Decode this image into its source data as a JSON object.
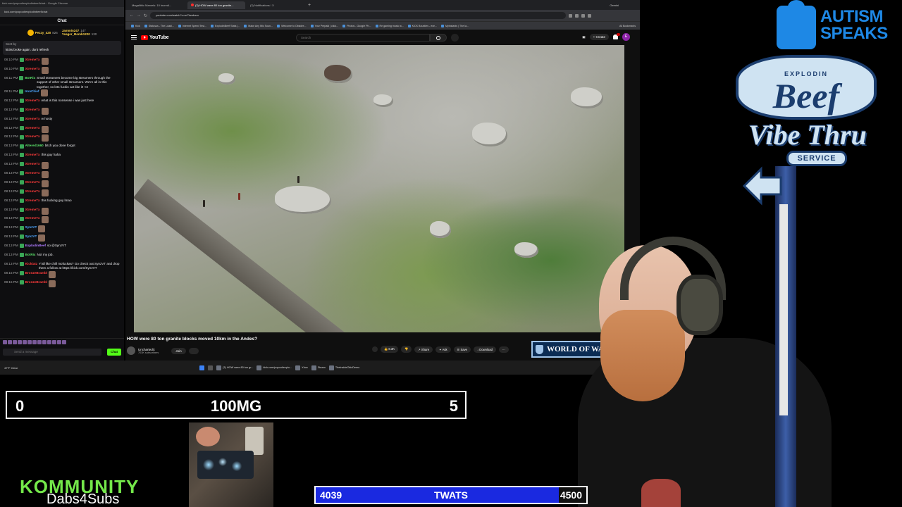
{
  "chat_window": {
    "title": "kick.com/popout/explodinbeef/chat - Google Chrome",
    "url": "kick.com/popout/explodinbeef/chat",
    "header": "Chat",
    "leaders": [
      {
        "name": "Pezzy_420",
        "points": "826"
      },
      {
        "name": "Jammin247",
        "points": "147"
      },
      {
        "name": "Yeager_Bomb1220",
        "points": "130"
      }
    ],
    "pinned": {
      "by": "Sent by",
      "text": "kicks broke again. dont refresh"
    },
    "messages": [
      {
        "time": "08:10 PM",
        "user": "XtremeTx",
        "color": "#ff3b3b",
        "text": ""
      },
      {
        "time": "08:10 PM",
        "user": "XtremeTx",
        "color": "#ff3b3b",
        "text": ""
      },
      {
        "time": "08:11 PM",
        "user": "BotRix",
        "color": "#5be36a",
        "text": "Small streamers become big streamers through the support of other small streamers. We're all in this together, so lets fuckin act like it! <3"
      },
      {
        "time": "08:11 PM",
        "user": "IronChief",
        "color": "#4ea7ff",
        "text": ""
      },
      {
        "time": "08:12 PM",
        "user": "XtremeTx",
        "color": "#ff3b3b",
        "text": "what is this nonsense i was just here"
      },
      {
        "time": "08:12 PM",
        "user": "XtremeTx",
        "color": "#ff3b3b",
        "text": ""
      },
      {
        "time": "08:12 PM",
        "user": "XtremeTx",
        "color": "#ff3b3b",
        "text": "w hosty"
      },
      {
        "time": "08:12 PM",
        "user": "XtremeTx",
        "color": "#ff3b3b",
        "text": ""
      },
      {
        "time": "08:12 PM",
        "user": "XtremeTx",
        "color": "#ff3b3b",
        "text": ""
      },
      {
        "time": "08:13 PM",
        "user": "Altered1660",
        "color": "#5be36a",
        "text": "bitch you done forgot"
      },
      {
        "time": "08:13 PM",
        "user": "XtremeTx",
        "color": "#ff3b3b",
        "text": "this guy haha"
      },
      {
        "time": "08:13 PM",
        "user": "XtremeTx",
        "color": "#ff3b3b",
        "text": ""
      },
      {
        "time": "08:13 PM",
        "user": "XtremeTx",
        "color": "#ff3b3b",
        "text": ""
      },
      {
        "time": "08:13 PM",
        "user": "XtremeTx",
        "color": "#ff3b3b",
        "text": ""
      },
      {
        "time": "08:13 PM",
        "user": "XtremeTx",
        "color": "#ff3b3b",
        "text": ""
      },
      {
        "time": "08:13 PM",
        "user": "XtremeTx",
        "color": "#ff3b3b",
        "text": "this fucking guy lmao"
      },
      {
        "time": "08:13 PM",
        "user": "XtremeTx",
        "color": "#ff3b3b",
        "text": ""
      },
      {
        "time": "08:13 PM",
        "user": "XtremeTx",
        "color": "#ff3b3b",
        "text": ""
      },
      {
        "time": "08:13 PM",
        "user": "SynzVT",
        "color": "#4ea7ff",
        "text": ""
      },
      {
        "time": "08:13 PM",
        "user": "SynzVT",
        "color": "#4ea7ff",
        "text": ""
      },
      {
        "time": "08:13 PM",
        "user": "ExplodinBeef",
        "color": "#b07bff",
        "text": "so @SynzVT"
      },
      {
        "time": "08:13 PM",
        "user": "BotRix",
        "color": "#5be36a",
        "text": "Not my job."
      },
      {
        "time": "08:13 PM",
        "user": "Kickiatz",
        "color": "#ff3b3b",
        "text": "Y'all like chill mofuckas? Go check out SynzVT and drop them a follow at https://kick.com/SynzVT"
      },
      {
        "time": "08:15 PM",
        "user": "BronzeBrambl",
        "color": "#ff3b3b",
        "text": ""
      },
      {
        "time": "08:15 PM",
        "user": "BronzeBrambl",
        "color": "#ff3b3b",
        "text": ""
      }
    ],
    "input_placeholder": "Send a message",
    "send_label": "Chat"
  },
  "browser": {
    "tabs": [
      {
        "label": "Megalithic Marvels: 10 Incredi...",
        "active": false
      },
      {
        "label": "(3) HOW were 80 ton granite...",
        "active": true
      },
      {
        "label": "(3) Notifications / X",
        "active": false
      }
    ],
    "gemini_label": "Gemini",
    "url": "youtube.com/watch?v=m7bzebzzc",
    "bookmarks": [
      "Kick",
      "Statusus - The Loadi...",
      "Internet Speed Test...",
      "ExplodinBeef Stats |...",
      "Make Any Mic Soun...",
      "Welcome to Obsidre...",
      "Your Prepaid | click...",
      "Photos - Google Ph...",
      "Re gaming music w...",
      "KICK Bounties - exe...",
      "Myinstants | The la..."
    ],
    "bookmarks_all": "All Bookmarks"
  },
  "youtube": {
    "logo": "YouTube",
    "search_placeholder": "Search",
    "create_label": "Create",
    "avatar_letter": "E",
    "video_title": "HOW were 80 ton granite blocks moved 10km in the Andes?",
    "channel_name": "UnchartedX",
    "subscribers": "703K subscribers",
    "join_label": "Join",
    "likes": "8.3K",
    "share_label": "Share",
    "ask_label": "Ask",
    "save_label": "Save",
    "download_label": "Download"
  },
  "ad_banner": {
    "text": "WORLD OF WA"
  },
  "taskbar": {
    "weather": "47°F Clear",
    "apps": [
      "(3) HOW were 80 ton gr...",
      "kick.com/popout/explo...",
      "Xbox",
      "Steam",
      "TheInsideOkizDemo"
    ]
  },
  "overlays": {
    "autism_speaks": "AUTISM SPEAKS",
    "sign_top": "EXPLODIN",
    "sign_main": "Beef",
    "sign_vibe": "Vibe Thru",
    "sign_service": "SERVICE",
    "scoreboard": {
      "left": "0",
      "center": "100MG",
      "right": "5"
    },
    "kommunity": "KOMMUNITY",
    "dabs": "Dabs4Subs",
    "goal": {
      "current": "4039",
      "label": "TWATS",
      "target": "4500",
      "fill_fraction": 0.8976
    }
  }
}
